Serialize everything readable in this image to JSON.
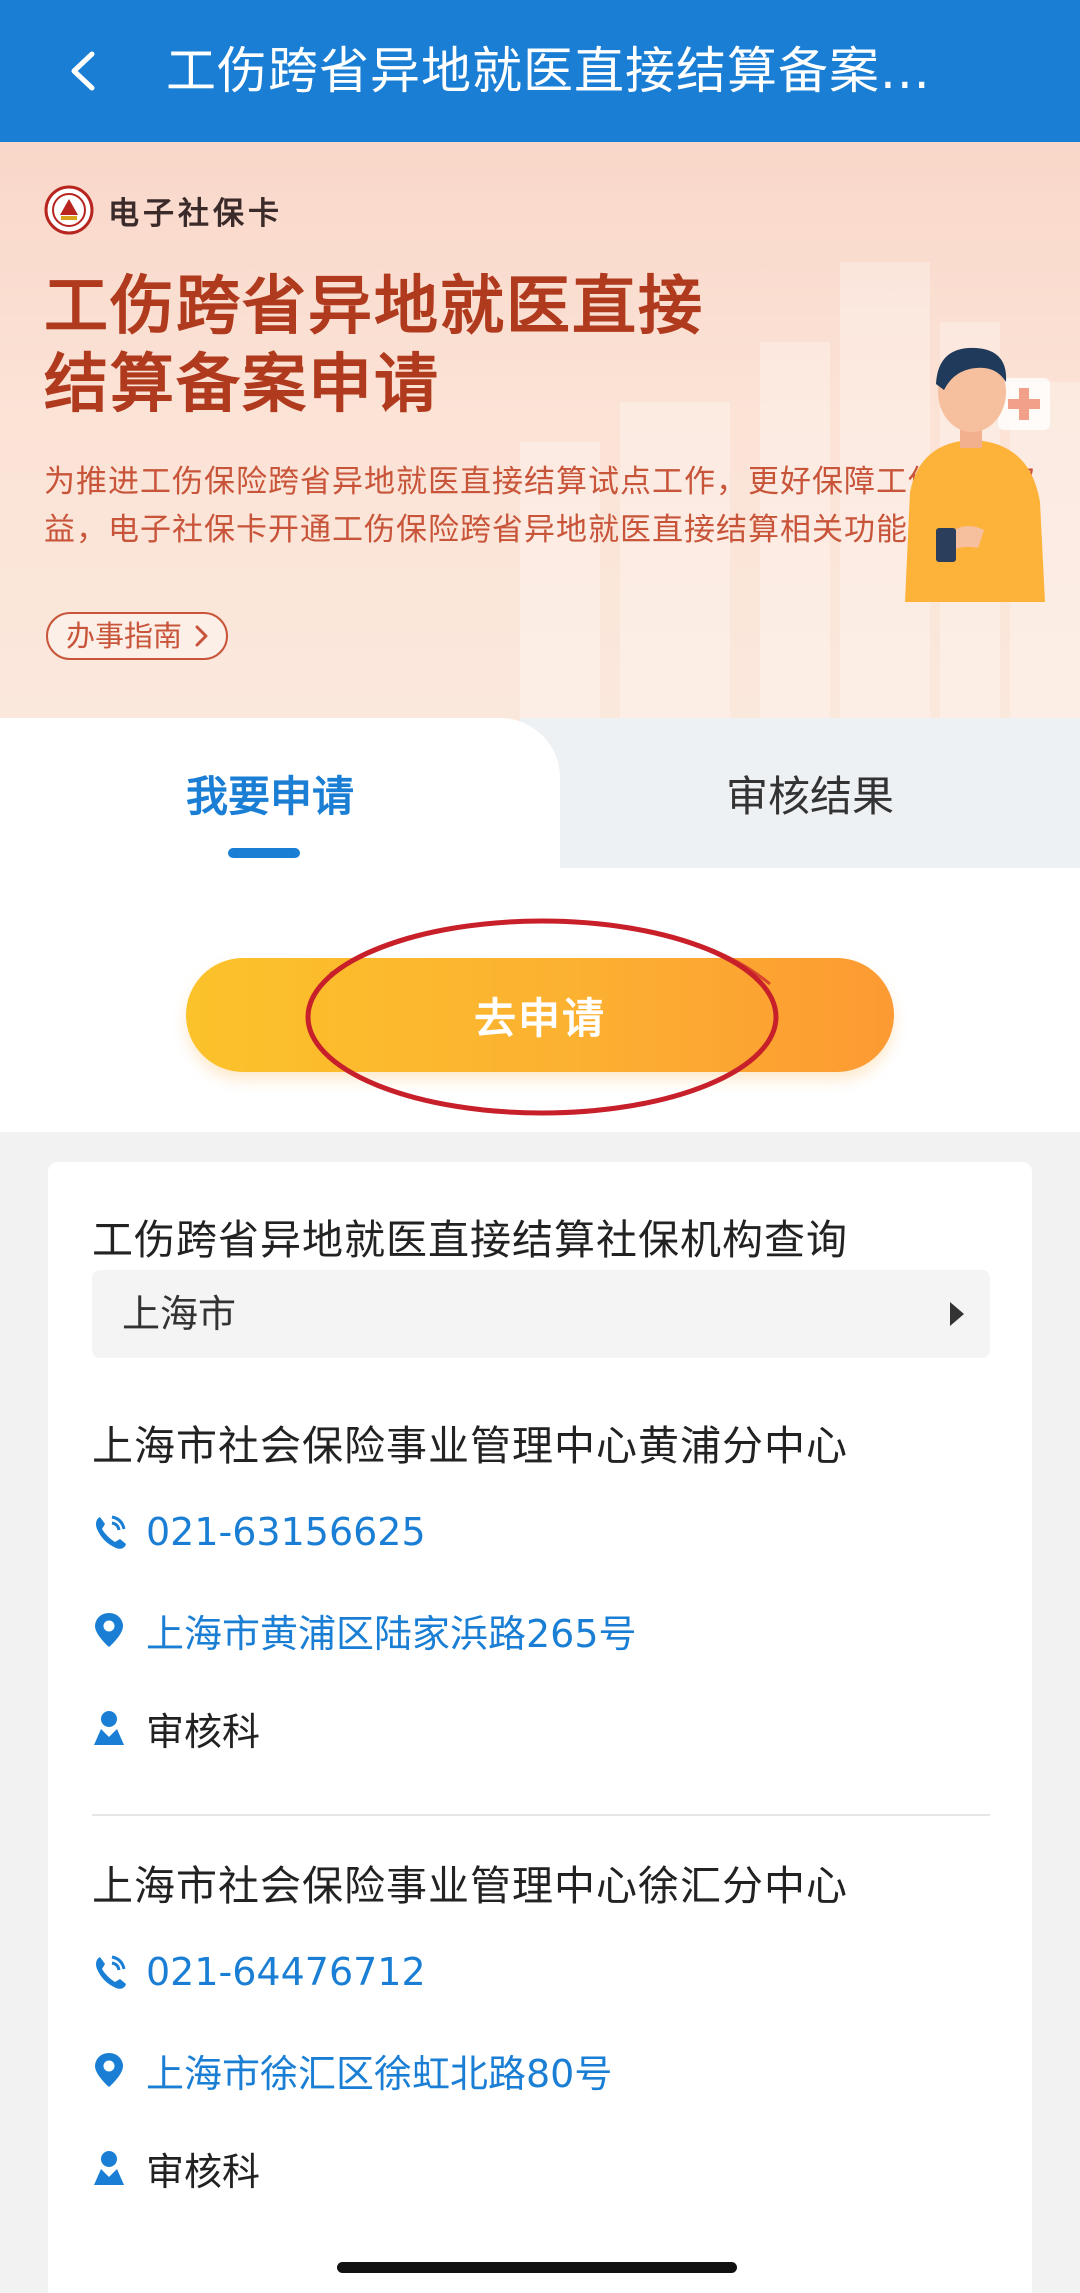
{
  "header": {
    "title": "工伤跨省异地就医直接结算备案..."
  },
  "banner": {
    "brand": "电子社保卡",
    "title_line1": "工伤跨省异地就医直接",
    "title_line2": "结算备案申请",
    "description": "为推进工伤保险跨省异地就医直接结算试点工作，更好保障工伤职工权益，电子社保卡开通工伤保险跨省异地就医直接结算相关功能。",
    "guide_label": "办事指南"
  },
  "tabs": [
    {
      "label": "我要申请",
      "active": true
    },
    {
      "label": "审核结果",
      "active": false
    }
  ],
  "apply": {
    "button_label": "去申请"
  },
  "query": {
    "title": "工伤跨省异地就医直接结算社保机构查询",
    "city": "上海市",
    "orgs": [
      {
        "name": "上海市社会保险事业管理中心黄浦分中心",
        "phone": "021-63156625",
        "address": "上海市黄浦区陆家浜路265号",
        "dept": "审核科"
      },
      {
        "name": "上海市社会保险事业管理中心徐汇分中心",
        "phone": "021-64476712",
        "address": "上海市徐汇区徐虹北路80号",
        "dept": "审核科"
      }
    ]
  },
  "colors": {
    "appbar": "#1a7fd4",
    "accent_blue": "#1a7fd4",
    "hero_title": "#b03a1e",
    "hero_text": "#c8553a",
    "button_orange": "#fcb131",
    "annotation_red": "#c8202a"
  },
  "icons": {
    "back": "chevron-left-icon",
    "phone": "phone-icon",
    "location": "location-pin-icon",
    "person": "person-icon",
    "guide_arrow": "chevron-right-icon",
    "select_arrow": "caret-right-icon"
  }
}
